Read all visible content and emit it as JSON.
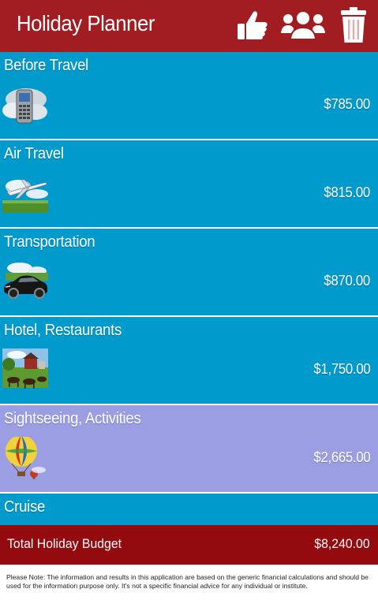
{
  "header": {
    "title": "Holiday Planner",
    "icons": [
      "thumbs-up-icon",
      "users-icon",
      "trash-icon"
    ]
  },
  "colors": {
    "header_bg": "#a11d22",
    "item_bg": "#009acd",
    "item_selected_bg": "#9c9ee3",
    "footer_bg": "#930b0e"
  },
  "items": [
    {
      "label": "Before Travel",
      "amount": "$785.00",
      "icon": "phone-on-clouds-image"
    },
    {
      "label": "Air Travel",
      "amount": "$815.00",
      "icon": "airplane-image"
    },
    {
      "label": "Transportation",
      "amount": "$870.00",
      "icon": "car-image"
    },
    {
      "label": "Hotel, Restaurants",
      "amount": "$1,750.00",
      "icon": "farm-landscape-image"
    },
    {
      "label": "Sightseeing, Activities",
      "amount": "$2,665.00",
      "icon": "hot-air-balloon-image",
      "selected": true
    },
    {
      "label": "Cruise",
      "amount": "",
      "icon": ""
    }
  ],
  "footer": {
    "label": "Total Holiday Budget",
    "value": "$8,240.00"
  },
  "note": "Please Note: The information and results in this application are based on the generic financial calculations and should be used for the information purpose only. It's not a specific financial advice for any individual or institute."
}
